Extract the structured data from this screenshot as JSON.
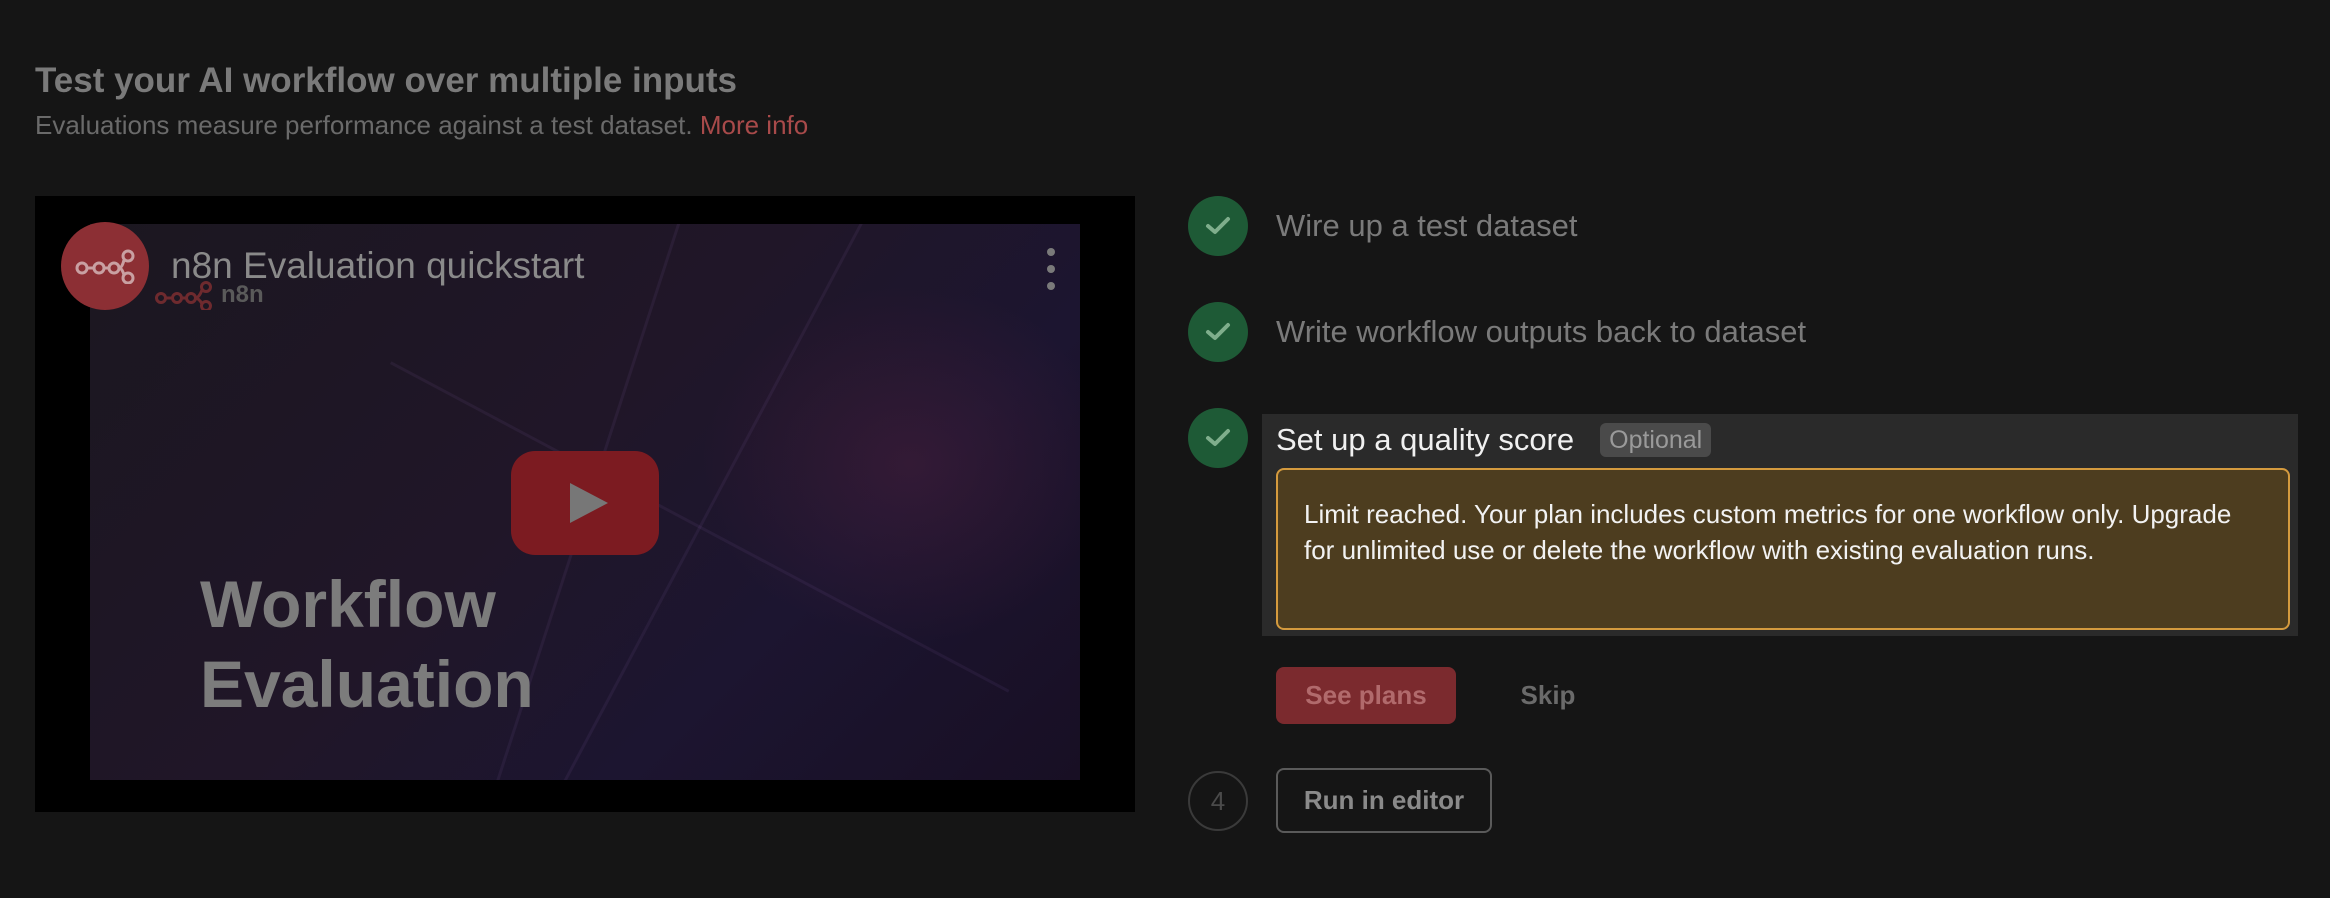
{
  "header": {
    "title": "Test your AI workflow over multiple inputs",
    "subtitle": "Evaluations measure performance against a test dataset.",
    "more_info": "More info"
  },
  "video": {
    "title": "n8n Evaluation quickstart",
    "brand": "n8n",
    "thumbnail_line1": "Workflow",
    "thumbnail_line2": "Evaluation"
  },
  "steps": [
    {
      "label": "Wire up a test dataset",
      "status": "done"
    },
    {
      "label": "Write workflow outputs back to dataset",
      "status": "done"
    },
    {
      "label": "Set up a quality score",
      "status": "done",
      "badge": "Optional"
    },
    {
      "number": "4",
      "status": "todo"
    }
  ],
  "quality": {
    "limit_message": "Limit reached. Your plan includes custom metrics for one workflow only. Upgrade for unlimited use or delete the workflow with existing evaluation runs.",
    "see_plans": "See plans",
    "skip": "Skip"
  },
  "run": {
    "label": "Run in editor"
  },
  "colors": {
    "background": "#151515",
    "success": "#1e5a36",
    "accent": "#7b2a2e",
    "warning_border": "#d49a3e",
    "warning_bg": "#4d3d1f"
  }
}
